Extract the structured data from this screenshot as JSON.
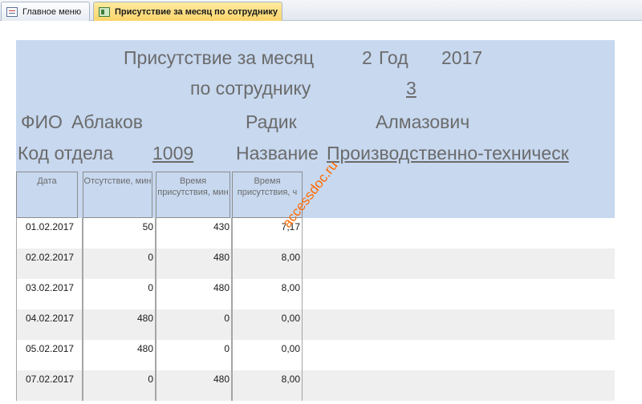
{
  "tabs": [
    {
      "label": "Главное меню",
      "icon": "form-icon"
    },
    {
      "label": "Присутствие за месяц по сотруднику",
      "icon": "report-icon",
      "active": true
    }
  ],
  "report": {
    "title": "Присутствие за месяц",
    "month": "2",
    "year_label": "Год",
    "year": "2017",
    "subtitle": "по сотруднику",
    "employee_id": "3",
    "fio_label": "ФИО",
    "last_name": "Аблаков",
    "first_name": "Радик",
    "middle_name": "Алмазович",
    "dept_code_label": "Код отдела",
    "dept_code": "1009",
    "dept_name_label": "Название",
    "dept_name": "Производственно-техническ"
  },
  "columns": [
    "Дата",
    "Отсутствие, мин",
    "Время присутствия, мин",
    "Время присутствия, ч"
  ],
  "rows": [
    {
      "date": "01.02.2017",
      "absent": "50",
      "present_min": "430",
      "present_h": "7,17"
    },
    {
      "date": "02.02.2017",
      "absent": "0",
      "present_min": "480",
      "present_h": "8,00"
    },
    {
      "date": "03.02.2017",
      "absent": "0",
      "present_min": "480",
      "present_h": "8,00"
    },
    {
      "date": "04.02.2017",
      "absent": "480",
      "present_min": "0",
      "present_h": "0,00"
    },
    {
      "date": "05.02.2017",
      "absent": "480",
      "present_min": "0",
      "present_h": "0,00"
    },
    {
      "date": "07.02.2017",
      "absent": "0",
      "present_min": "480",
      "present_h": "8,00"
    }
  ],
  "watermark": "accessdoc.ru",
  "colors": {
    "header_bg": "#c7d8ef",
    "active_tab": "#fbd56a",
    "watermark": "#ff6a00"
  }
}
